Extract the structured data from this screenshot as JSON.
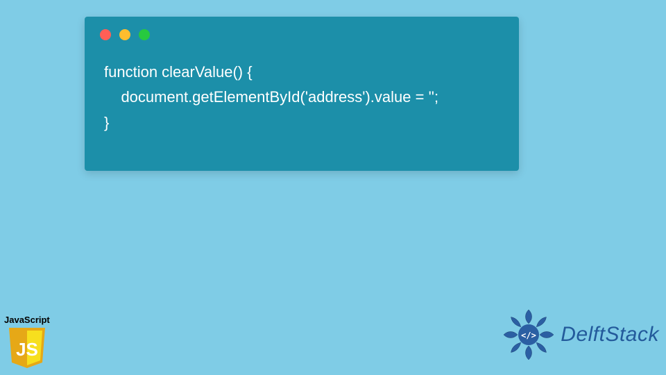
{
  "code": {
    "line1": "function clearValue() {",
    "line2": "    document.getElementById('address').value = '';",
    "line3": "}"
  },
  "jsBadge": {
    "label": "JavaScript",
    "shieldText": "JS"
  },
  "brand": {
    "name": "DelftStack",
    "iconGlyph": "</>"
  },
  "colors": {
    "pageBg": "#7fcce6",
    "windowBg": "#1c8fa9",
    "dotRed": "#ff5f56",
    "dotYellow": "#ffbd2e",
    "dotGreen": "#27c93f",
    "jsYellow": "#f7df1e",
    "brandBlue": "#235a9b"
  }
}
